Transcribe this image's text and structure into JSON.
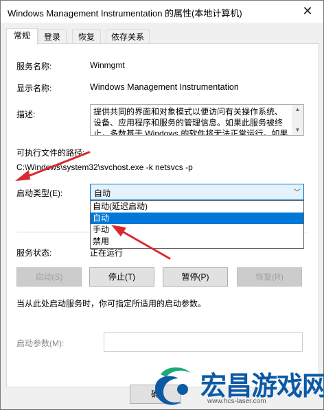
{
  "window": {
    "title": "Windows Management Instrumentation 的属性(本地计算机)",
    "close_glyph": "✕"
  },
  "tabs": [
    "常规",
    "登录",
    "恢复",
    "依存关系"
  ],
  "general": {
    "service_name_label": "服务名称:",
    "service_name": "Winmgmt",
    "display_name_label": "显示名称:",
    "display_name": "Windows Management Instrumentation",
    "description_label": "描述:",
    "description": "提供共同的界面和对象模式以便访问有关操作系统、设备、应用程序和服务的管理信息。如果此服务被终止，多数基于 Windows 的软件将无法正常运行。如果此",
    "exe_path_label": "可执行文件的路径:",
    "exe_path": "C:\\Windows\\system32\\svchost.exe -k netsvcs -p",
    "startup_type_label": "启动类型(E):",
    "startup_type_value": "自动",
    "startup_options": [
      "自动(延迟启动)",
      "自动",
      "手动",
      "禁用"
    ],
    "startup_selected_index": 1,
    "service_status_label": "服务状态:",
    "service_status": "正在运行",
    "buttons": {
      "start": "启动(S)",
      "stop": "停止(T)",
      "pause": "暂停(P)",
      "resume": "恢复(R)"
    },
    "hint": "当从此处启动服务时，你可指定所适用的启动参数。",
    "start_params_label": "启动参数(M):",
    "start_params_value": "",
    "ok_button_partial": "确"
  },
  "watermark": {
    "title": "宏昌游戏网",
    "url": "www.hcs-laser.com"
  },
  "colors": {
    "accent": "#0078d7",
    "arrow": "#d9282f",
    "watermark": "#0b5aa6"
  }
}
